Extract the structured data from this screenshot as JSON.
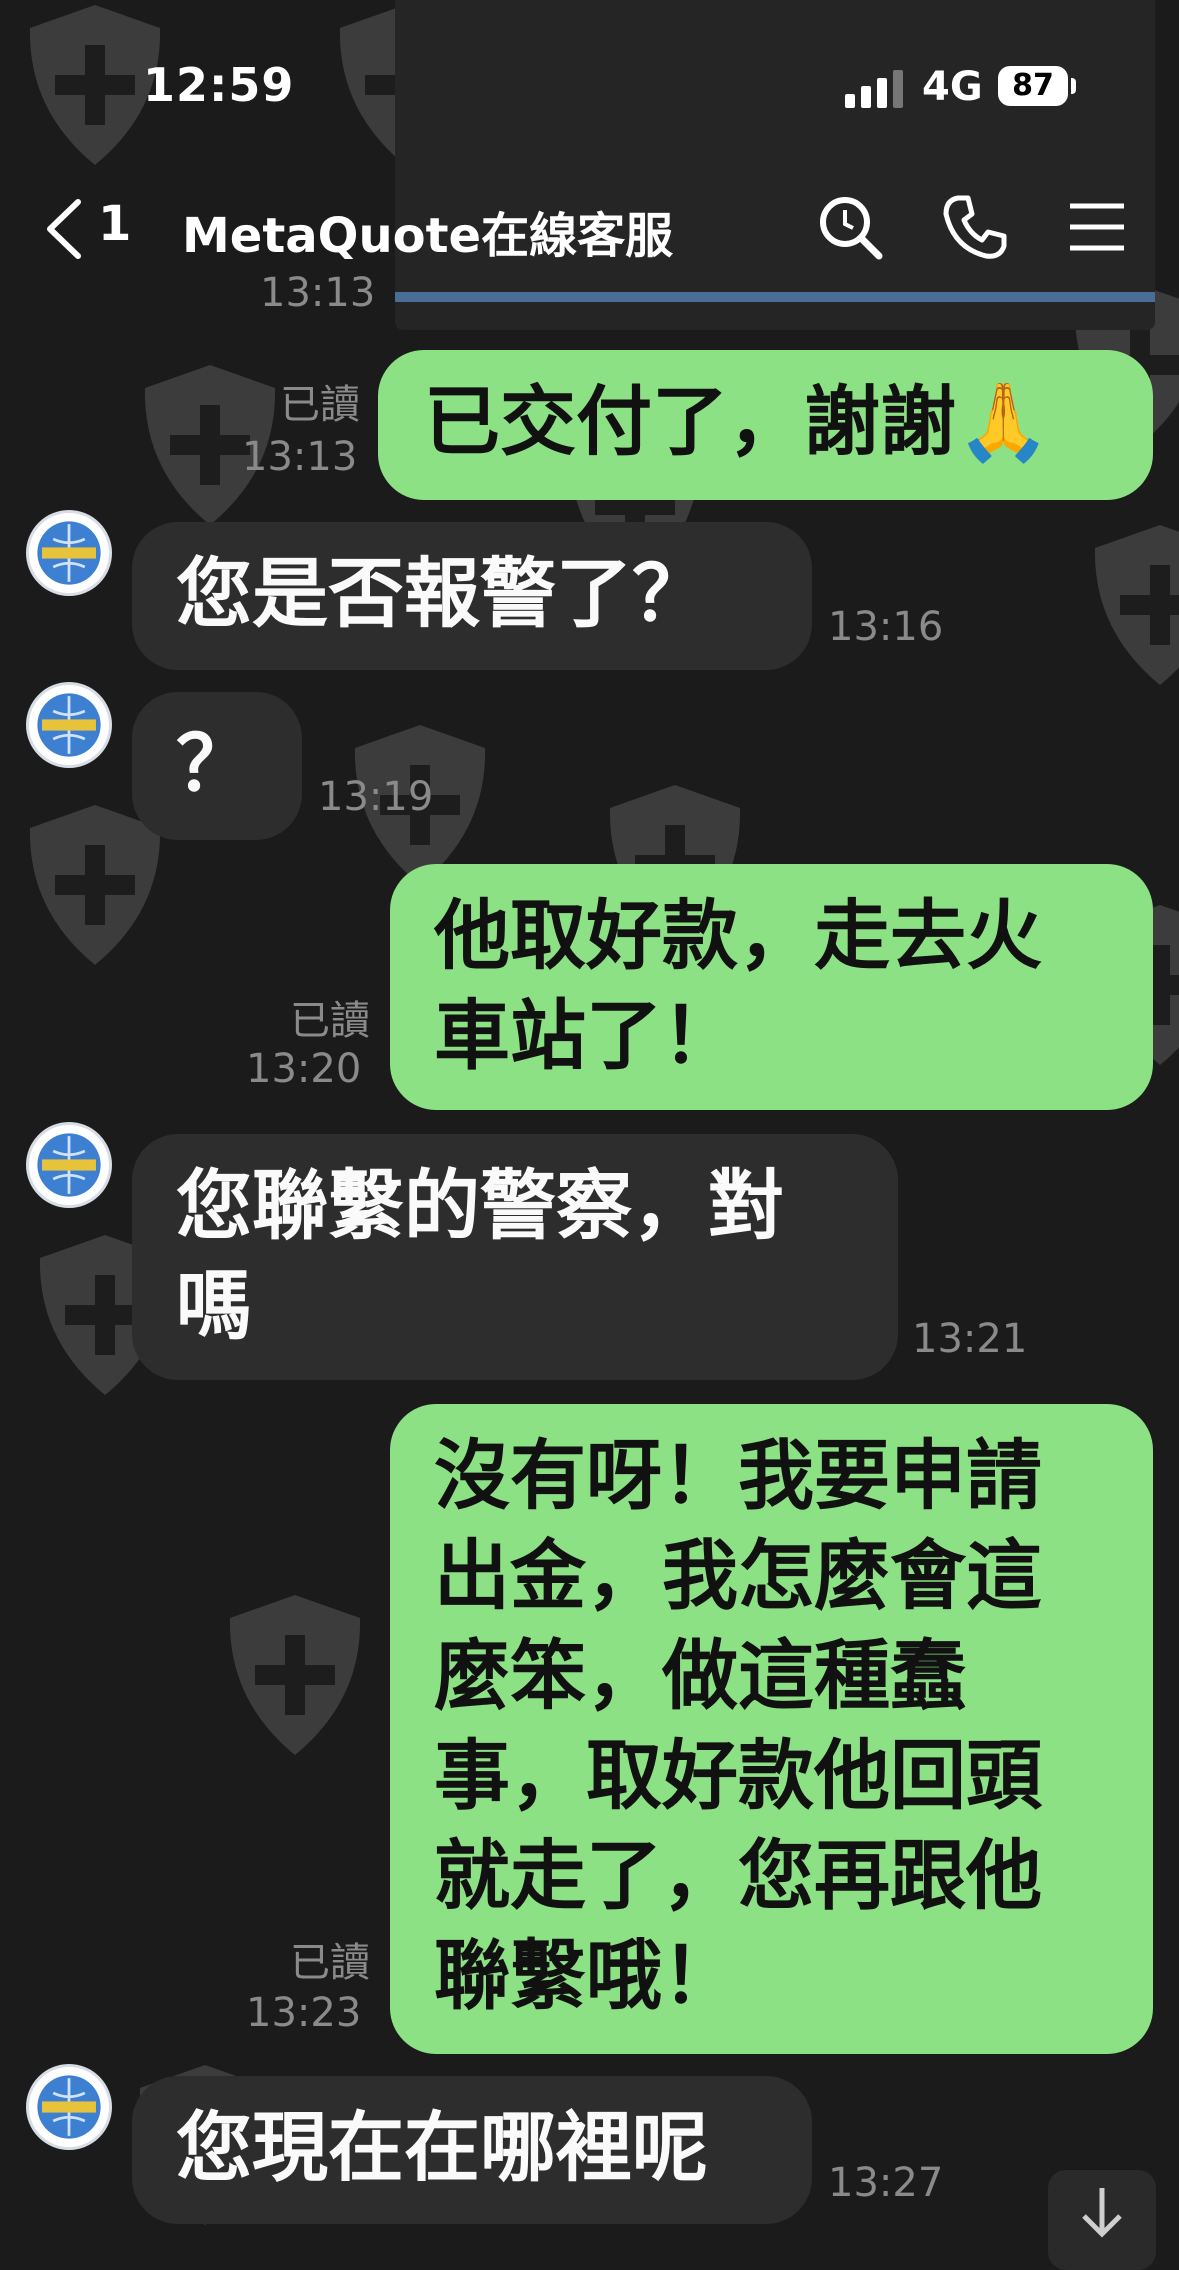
{
  "status_bar": {
    "time": "12:59",
    "network": "4G",
    "battery": "87"
  },
  "header": {
    "back_count": "1",
    "title": "MetaQuote在線客服",
    "icons": [
      "back-chevron-icon",
      "search-icon",
      "phone-icon",
      "menu-icon"
    ]
  },
  "prev_time": "13:13",
  "messages": [
    {
      "side": "out",
      "text": "已交付了，謝謝🙏",
      "read": "已讀",
      "time": "13:13"
    },
    {
      "side": "in",
      "text": "您是否報警了？",
      "time": "13:16"
    },
    {
      "side": "in",
      "text": "？",
      "time": "13:19"
    },
    {
      "side": "out",
      "text": "他取好款，走去火車站了！",
      "read": "已讀",
      "time": "13:20"
    },
    {
      "side": "in",
      "text": "您聯繫的警察，對嗎",
      "time": "13:21"
    },
    {
      "side": "out",
      "text": "沒有呀！我要申請出金，我怎麼會這麼笨，做這種蠢事，取好款他回頭就走了，您再跟他聯繫哦！",
      "read": "已讀",
      "time": "13:23"
    },
    {
      "side": "in",
      "text": "您現在在哪裡呢",
      "time": "13:27"
    }
  ],
  "colors": {
    "background": "#1b1b1b",
    "incoming_bubble": "#2d2d2d",
    "outgoing_bubble": "#8de185",
    "meta_text": "#8a8a8a"
  }
}
